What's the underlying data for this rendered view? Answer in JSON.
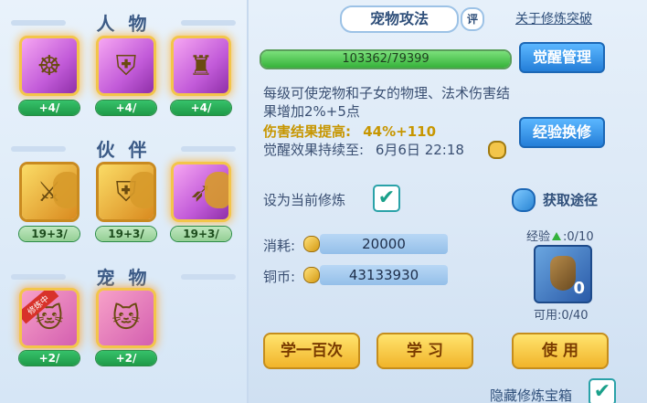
{
  "left": {
    "sections": [
      {
        "title": "人 物",
        "cards": [
          {
            "level": "+4/"
          },
          {
            "level": "+4/"
          },
          {
            "level": "+4/"
          }
        ]
      },
      {
        "title": "伙 伴",
        "cards": [
          {
            "level": "19+3/"
          },
          {
            "level": "19+3/"
          },
          {
            "level": "19+3/"
          }
        ]
      },
      {
        "title": "宠 物",
        "cards": [
          {
            "level": "+2/",
            "tag": "修炼中"
          },
          {
            "level": "+2/"
          }
        ]
      }
    ]
  },
  "right": {
    "tab_title": "宠物攻法",
    "rate_icon_label": "评",
    "link_label": "关于修炼突破",
    "progress_text": "103362/79399",
    "progress_ratio": 1.0,
    "awaken_button": "觉醒管理",
    "description": "每级可使宠物和子女的物理、法术伤害结果增加2%+5点",
    "damage_label": "伤害结果提高:",
    "damage_value": "44%+110",
    "duration_label": "觉醒效果持续至:",
    "duration_value": "6月6日 22:18",
    "exp_exchange_button": "经验换修",
    "set_current_label": "设为当前修炼",
    "set_current_checked": "✔",
    "get_source_label": "获取途径",
    "consume_label": "消耗:",
    "consume_value": "20000",
    "copper_label": "铜币:",
    "copper_value": "43133930",
    "exp_label": "经验",
    "exp_value": ":0/10",
    "item_count": "0",
    "usable_label": "可用:0/40",
    "buttons": {
      "learn_100": "学一百次",
      "learn": "学 习",
      "use": "使 用"
    },
    "hide_chest_label": "隐藏修炼宝箱",
    "hide_chest_checked": "✔"
  }
}
